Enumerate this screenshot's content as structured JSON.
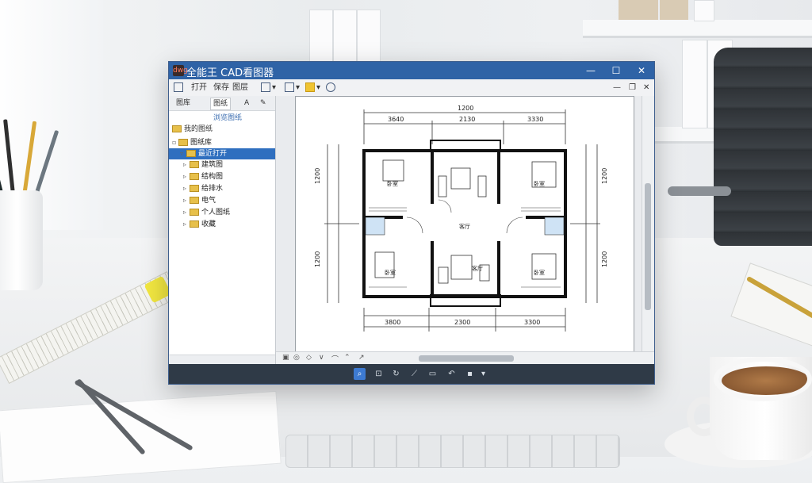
{
  "app": {
    "title": "全能王 CAD看图器",
    "logo_text": "dwg",
    "window_controls": {
      "minimize": "—",
      "maximize": "☐",
      "close": "✕"
    },
    "doc_controls": {
      "minimize": "—",
      "restore": "❐",
      "close": "✕"
    }
  },
  "toolbar": {
    "items": [
      {
        "icon": "open-file-icon",
        "label": ""
      },
      {
        "icon": "",
        "label": "打开"
      },
      {
        "icon": "",
        "label": "保存"
      },
      {
        "icon": "",
        "label": "图层"
      }
    ],
    "tools": [
      "cursor-icon",
      "measure-icon",
      "highlight-icon",
      "pin-icon"
    ]
  },
  "sidebar": {
    "tabs": [
      {
        "label": "图库"
      },
      {
        "label": "图纸"
      },
      {
        "label": "A"
      },
      {
        "label": "✎"
      }
    ],
    "subheader": "浏览图纸",
    "section": "我的图纸",
    "tree": [
      {
        "label": "图纸库",
        "expanded": true,
        "selected": false
      },
      {
        "label": "最近打开",
        "expanded": false,
        "selected": true
      },
      {
        "label": "建筑图",
        "expanded": false,
        "selected": false
      },
      {
        "label": "结构图",
        "expanded": false,
        "selected": false
      },
      {
        "label": "给排水",
        "expanded": false,
        "selected": false
      },
      {
        "label": "电气",
        "expanded": false,
        "selected": false
      },
      {
        "label": "个人图纸",
        "expanded": false,
        "selected": false
      },
      {
        "label": "收藏",
        "expanded": false,
        "selected": false
      }
    ]
  },
  "drawing": {
    "top_dims": {
      "total": "1200",
      "left": "3640",
      "mid": "2130",
      "right": "3330"
    },
    "bottom_dims": {
      "left": "3800",
      "mid": "2300",
      "right": "3300"
    },
    "left_dims": {
      "upper": "1200",
      "lower": "1200"
    },
    "right_dims": {
      "upper": "1200",
      "lower": "1200"
    },
    "room_labels": [
      "卧室",
      "卧室",
      "客厅",
      "卧室",
      "客厅",
      "卧室"
    ]
  },
  "bottom_tools": [
    "zoom-window-icon",
    "pan-icon",
    "rotate-icon",
    "measure-icon",
    "layer-icon",
    "undo-icon",
    "page-icon"
  ],
  "hbar_tools": [
    "▣",
    "◎",
    "◇",
    "∨",
    "⌒",
    "⌃",
    "↗"
  ],
  "colors": {
    "titlebar": "#2f63a6",
    "selection": "#2f6fbf",
    "status_bar": "#2f3a47"
  }
}
